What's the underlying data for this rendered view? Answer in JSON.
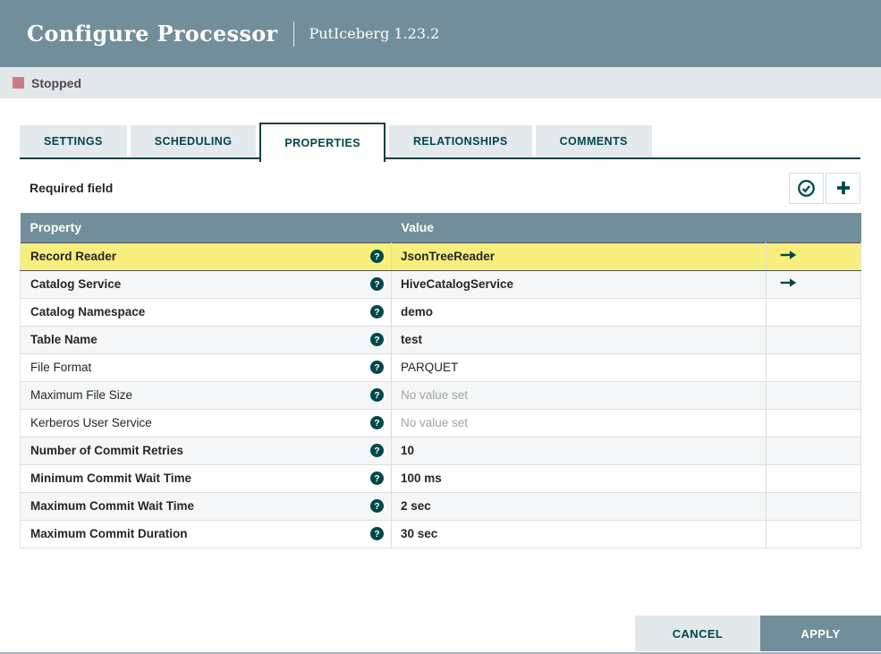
{
  "dialog": {
    "title": "Configure Processor",
    "subtitle": "PutIceberg 1.23.2"
  },
  "status": {
    "label": "Stopped",
    "color": "#C97D82"
  },
  "tabs": [
    {
      "label": "SETTINGS",
      "active": false
    },
    {
      "label": "SCHEDULING",
      "active": false
    },
    {
      "label": "PROPERTIES",
      "active": true
    },
    {
      "label": "RELATIONSHIPS",
      "active": false
    },
    {
      "label": "COMMENTS",
      "active": false
    }
  ],
  "panel": {
    "required_field_label": "Required field"
  },
  "icons": {
    "verify_properties": "check-circle",
    "add_property": "plus",
    "help": "?",
    "goto_service": "right-arrow"
  },
  "table": {
    "columns": {
      "property": "Property",
      "value": "Value"
    },
    "rows": [
      {
        "property": "Record Reader",
        "value": "JsonTreeReader",
        "required": true,
        "selected": true,
        "goto": true,
        "no_value": false
      },
      {
        "property": "Catalog Service",
        "value": "HiveCatalogService",
        "required": true,
        "selected": false,
        "goto": true,
        "no_value": false
      },
      {
        "property": "Catalog Namespace",
        "value": "demo",
        "required": true,
        "selected": false,
        "goto": false,
        "no_value": false
      },
      {
        "property": "Table Name",
        "value": "test",
        "required": true,
        "selected": false,
        "goto": false,
        "no_value": false
      },
      {
        "property": "File Format",
        "value": "PARQUET",
        "required": false,
        "selected": false,
        "goto": false,
        "no_value": false
      },
      {
        "property": "Maximum File Size",
        "value": "No value set",
        "required": false,
        "selected": false,
        "goto": false,
        "no_value": true
      },
      {
        "property": "Kerberos User Service",
        "value": "No value set",
        "required": false,
        "selected": false,
        "goto": false,
        "no_value": true
      },
      {
        "property": "Number of Commit Retries",
        "value": "10",
        "required": true,
        "selected": false,
        "goto": false,
        "no_value": false
      },
      {
        "property": "Minimum Commit Wait Time",
        "value": "100 ms",
        "required": true,
        "selected": false,
        "goto": false,
        "no_value": false
      },
      {
        "property": "Maximum Commit Wait Time",
        "value": "2 sec",
        "required": true,
        "selected": false,
        "goto": false,
        "no_value": false
      },
      {
        "property": "Maximum Commit Duration",
        "value": "30 sec",
        "required": true,
        "selected": false,
        "goto": false,
        "no_value": false
      }
    ]
  },
  "footer": {
    "cancel_label": "CANCEL",
    "apply_label": "APPLY"
  },
  "colors": {
    "header_bg": "#728E9B",
    "accent_teal": "#004849",
    "selected_row": "#F6EE7D",
    "alt_row": "#F4F6F7",
    "status_bar_bg": "#E2E7EA"
  }
}
